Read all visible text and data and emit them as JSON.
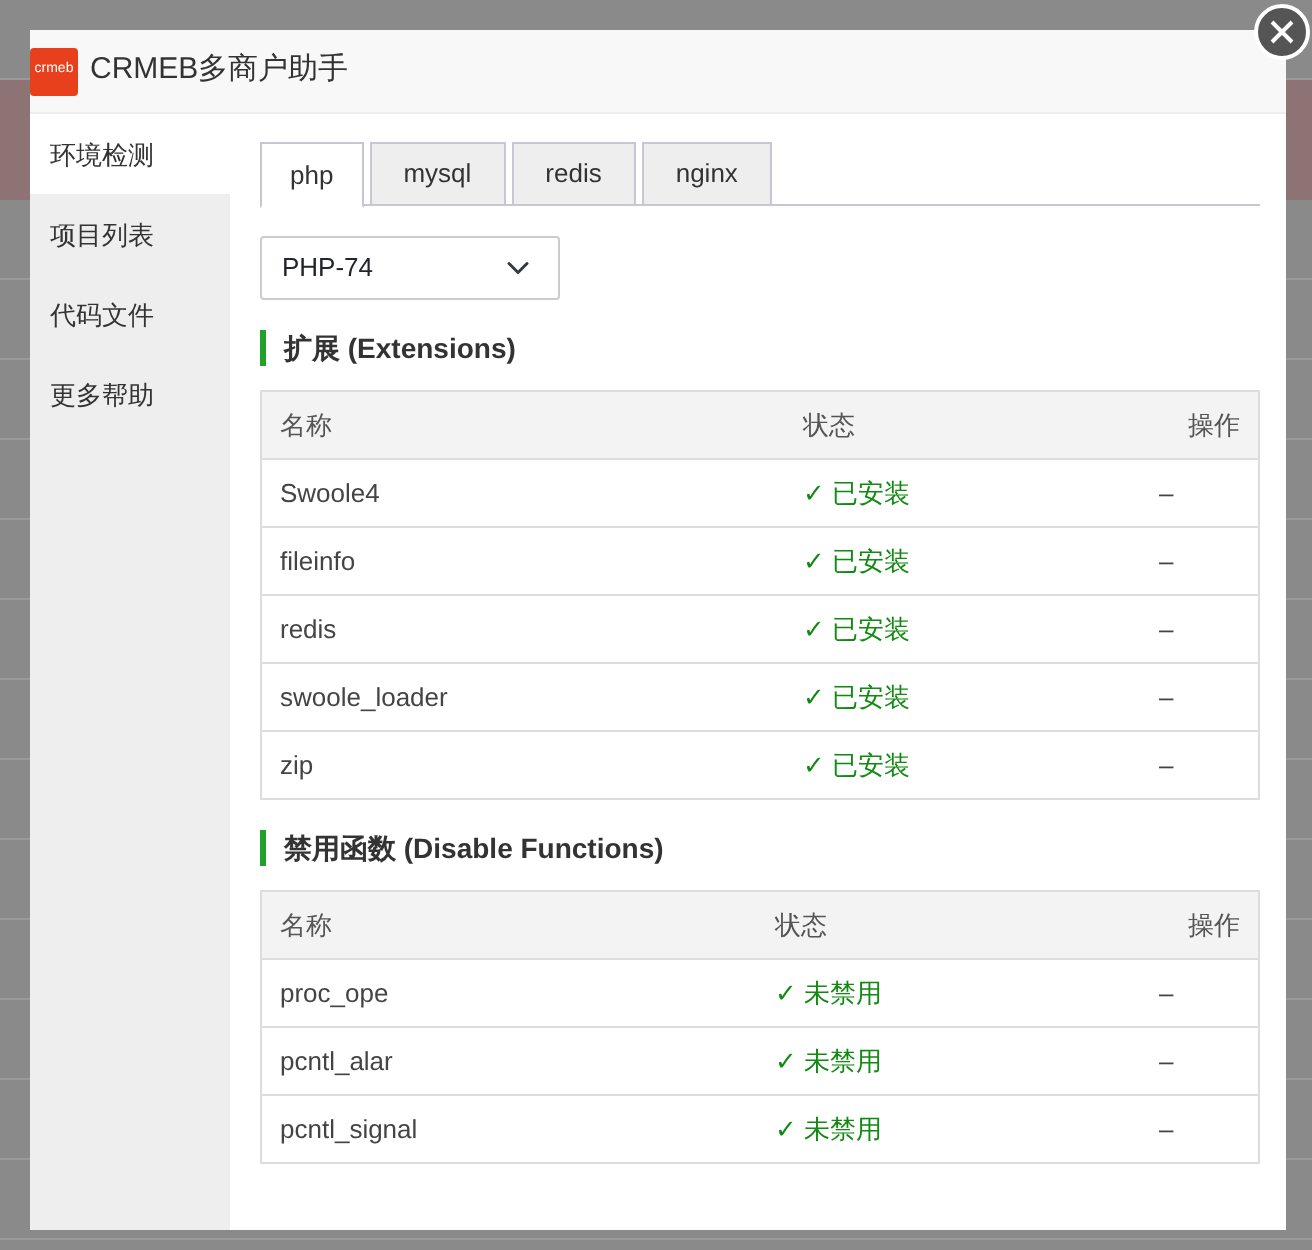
{
  "window": {
    "title": "CRMEB多商户助手",
    "logo": "crmeb"
  },
  "sidebar": {
    "items": [
      {
        "label": "环境检测",
        "selected": true
      },
      {
        "label": "项目列表",
        "selected": false
      },
      {
        "label": "代码文件",
        "selected": false
      },
      {
        "label": "更多帮助",
        "selected": false
      }
    ]
  },
  "tabs": [
    {
      "label": "php",
      "selected": true
    },
    {
      "label": "mysql",
      "selected": false
    },
    {
      "label": "redis",
      "selected": false
    },
    {
      "label": "nginx",
      "selected": false
    }
  ],
  "version_select": {
    "value": "PHP-74"
  },
  "sections": [
    {
      "title": "扩展 (Extensions)",
      "columns": [
        "名称",
        "状态",
        "操作"
      ],
      "rows": [
        {
          "name": "Swoole4",
          "status": "✓ 已安装",
          "ok": true,
          "action": "–"
        },
        {
          "name": "fileinfo",
          "status": "✓ 已安装",
          "ok": true,
          "action": "–"
        },
        {
          "name": "redis",
          "status": "✓ 已安装",
          "ok": true,
          "action": "–"
        },
        {
          "name": "swoole_loader",
          "status": "✓ 已安装",
          "ok": true,
          "action": "–"
        },
        {
          "name": "zip",
          "status": "✓ 已安装",
          "ok": true,
          "action": "–"
        }
      ]
    },
    {
      "title": "禁用函数 (Disable Functions)",
      "columns": [
        "名称",
        "状态",
        "操作"
      ],
      "rows": [
        {
          "name": "proc_ope",
          "status": "✓ 未禁用",
          "ok": true,
          "action": "–"
        },
        {
          "name": "pcntl_alar",
          "status": "✓ 未禁用",
          "ok": true,
          "action": "–"
        },
        {
          "name": "pcntl_signal",
          "status": "✓ 未禁用",
          "ok": true,
          "action": "–"
        }
      ]
    }
  ]
}
